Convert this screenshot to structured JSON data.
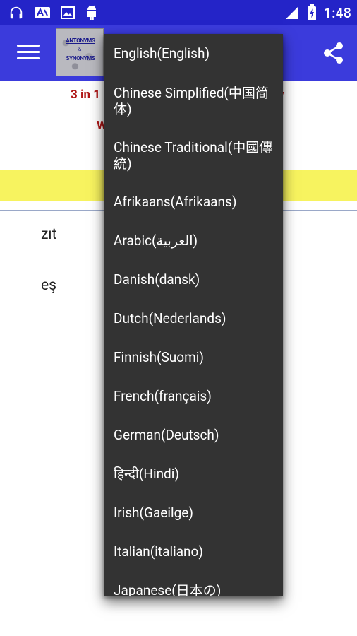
{
  "status_bar": {
    "time": "1:48",
    "icons": [
      "headphones-icon",
      "translate-icon",
      "image-icon",
      "android-icon",
      "signal-icon",
      "battery-icon"
    ]
  },
  "app_bar": {
    "logo": {
      "line1": "ANTONYMS",
      "line2": "&",
      "line3": "SYNONYMS"
    }
  },
  "content": {
    "tagline_start": "3 in 1",
    "tagline_end": "y",
    "line2": "W",
    "line3": "(",
    "rows": [
      {
        "text": "zıt"
      },
      {
        "text": "eş"
      }
    ]
  },
  "language_menu": {
    "items": [
      "English(English)",
      "Chinese Simplified(中国简体)",
      "Chinese Traditional(中國傳統)",
      "Afrikaans(Afrikaans)",
      "Arabic(العربية)",
      "Danish(dansk)",
      "Dutch(Nederlands)",
      "Finnish(Suomi)",
      "French(français)",
      "German(Deutsch)",
      "हिन्दी(Hindi)",
      "Irish(Gaeilge)",
      "Italian(italiano)",
      "Japanese(日本の)"
    ]
  },
  "colors": {
    "status_bar": "#2424c8",
    "app_bar": "#3b3bdc",
    "tagline": "#b01818",
    "band": "#f7f35f",
    "menu_bg": "#333333",
    "menu_text": "#ffffff"
  }
}
